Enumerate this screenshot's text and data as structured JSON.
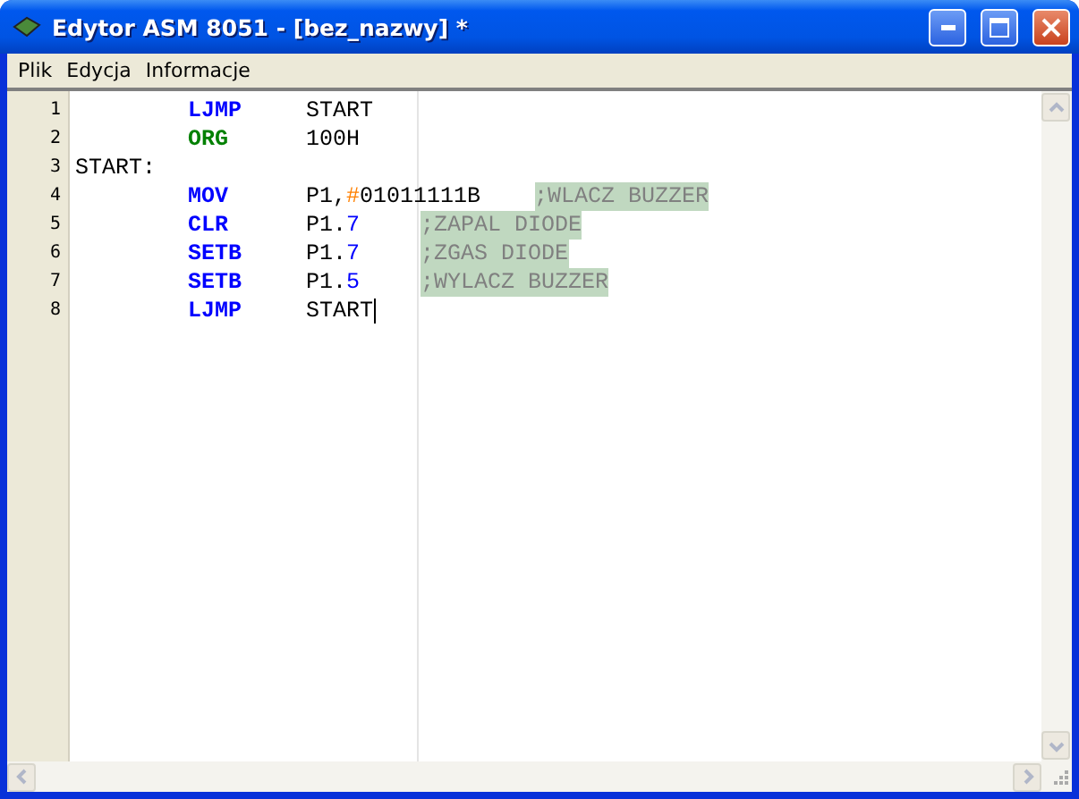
{
  "window": {
    "title": "Edytor ASM 8051 - [bez_nazwy] *"
  },
  "menu": [
    "Plik",
    "Edycja",
    "Informacje"
  ],
  "lines": [
    {
      "number": "1",
      "mnemonic": {
        "text": "LJMP",
        "kind": "instruction"
      },
      "operand": [
        {
          "text": "START",
          "kind": "plain"
        }
      ]
    },
    {
      "number": "2",
      "mnemonic": {
        "text": "ORG",
        "kind": "directive"
      },
      "operand": [
        {
          "text": "100H",
          "kind": "plain"
        }
      ]
    },
    {
      "number": "3",
      "label": "START:"
    },
    {
      "number": "4",
      "mnemonic": {
        "text": "MOV",
        "kind": "instruction"
      },
      "operand": [
        {
          "text": "P1,",
          "kind": "plain"
        },
        {
          "text": "#",
          "kind": "symbol"
        },
        {
          "text": "01011111B",
          "kind": "plain"
        }
      ],
      "comment": ";WLACZ BUZZER"
    },
    {
      "number": "5",
      "mnemonic": {
        "text": "CLR",
        "kind": "instruction"
      },
      "operand": [
        {
          "text": "P1.",
          "kind": "plain"
        },
        {
          "text": "7",
          "kind": "number"
        }
      ],
      "comment": ";ZAPAL DIODE"
    },
    {
      "number": "6",
      "mnemonic": {
        "text": "SETB",
        "kind": "instruction"
      },
      "operand": [
        {
          "text": "P1.",
          "kind": "plain"
        },
        {
          "text": "7",
          "kind": "number"
        }
      ],
      "comment": ";ZGAS DIODE"
    },
    {
      "number": "7",
      "mnemonic": {
        "text": "SETB",
        "kind": "instruction"
      },
      "operand": [
        {
          "text": "P1.",
          "kind": "plain"
        },
        {
          "text": "5",
          "kind": "number"
        }
      ],
      "comment": ";WYLACZ BUZZER"
    },
    {
      "number": "8",
      "mnemonic": {
        "text": "LJMP",
        "kind": "instruction"
      },
      "operand": [
        {
          "text": "START",
          "kind": "plain"
        }
      ],
      "cursor": true
    }
  ]
}
